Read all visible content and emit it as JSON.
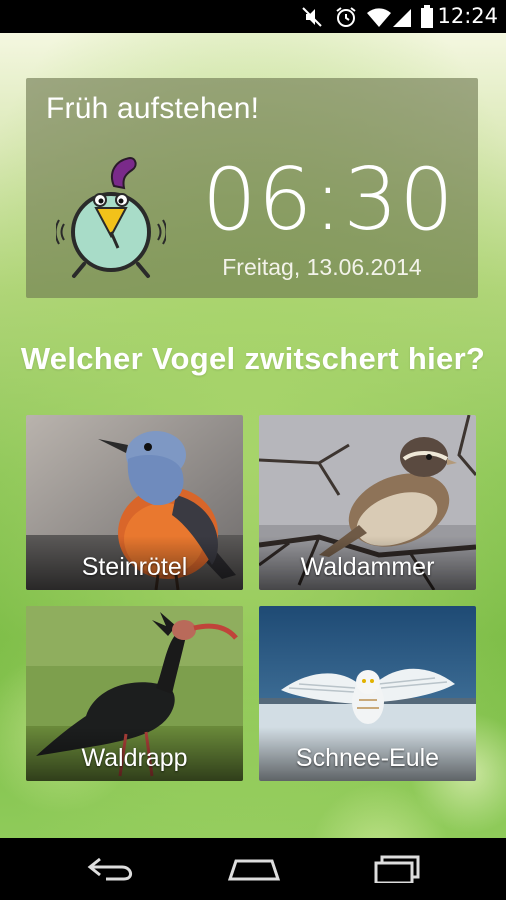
{
  "status_bar": {
    "time": "12:24",
    "icons": [
      "mute-icon",
      "alarm-clock-icon",
      "wifi-icon",
      "signal-icon",
      "battery-icon"
    ]
  },
  "alarm": {
    "title": "Früh aufstehen!",
    "time": "06:30",
    "date": "Freitag, 13.06.2014"
  },
  "quiz": {
    "question": "Welcher Vogel zwitschert hier?",
    "options": [
      {
        "label": "Steinrötel"
      },
      {
        "label": "Waldammer"
      },
      {
        "label": "Waldrapp"
      },
      {
        "label": "Schnee-Eule"
      }
    ]
  },
  "nav": {
    "buttons": [
      "back-icon",
      "home-icon",
      "recent-apps-icon"
    ]
  },
  "colors": {
    "card_bg": "#6e7850",
    "clock_face": "#a8dcc8",
    "clock_crest": "#7a2a8a",
    "clock_beak": "#f2c21a",
    "nav_bg": "#000000"
  }
}
